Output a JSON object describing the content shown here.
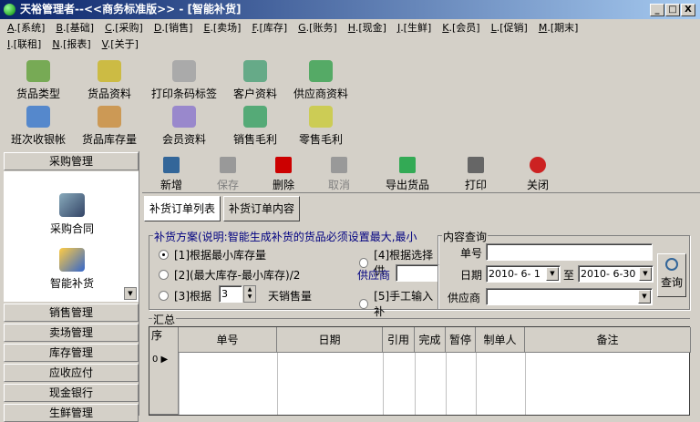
{
  "window": {
    "title": "天裕管理者--<<商务标准版>> - [智能补货]",
    "min": "_",
    "max": "□",
    "close": "X"
  },
  "menu_row1": [
    {
      "k": "A",
      "l": ".[系统]"
    },
    {
      "k": "B",
      "l": ".[基础]"
    },
    {
      "k": "C",
      "l": ".[采购]"
    },
    {
      "k": "D",
      "l": ".[销售]"
    },
    {
      "k": "E",
      "l": ".[卖场]"
    },
    {
      "k": "F",
      "l": ".[库存]"
    },
    {
      "k": "G",
      "l": ".[账务]"
    },
    {
      "k": "H",
      "l": ".[现金]"
    },
    {
      "k": "J",
      "l": ".[生鲜]"
    },
    {
      "k": "K",
      "l": ".[会员]"
    },
    {
      "k": "L",
      "l": ".[促销]"
    },
    {
      "k": "M",
      "l": ".[期末]"
    }
  ],
  "menu_row2": [
    {
      "k": "I",
      "l": ".[联租]"
    },
    {
      "k": "N",
      "l": ".[报表]"
    },
    {
      "k": "V",
      "l": ".[关于]"
    }
  ],
  "quick": [
    "货品类型",
    "货品资料",
    "打印条码标签",
    "客户资料",
    "供应商资料",
    "班次收银帐",
    "货品库存量",
    "会员资料",
    "销售毛利",
    "零售毛利"
  ],
  "left": {
    "header": "采购管理",
    "items": [
      "采购合同",
      "智能补货"
    ],
    "sections": [
      "销售管理",
      "卖场管理",
      "库存管理",
      "应收应付",
      "现金银行",
      "生鲜管理"
    ]
  },
  "toolbar": [
    "新增",
    "保存",
    "删除",
    "取消",
    "导出货品",
    "打印",
    "关闭"
  ],
  "tabs": [
    "补货订单列表",
    "补货订单内容"
  ],
  "plan": {
    "title": "补货方案(说明:智能生成补货的货品必须设置最大,最小",
    "opt1": "[1]根据最小库存量",
    "opt2": "[2](最大库存-最小库存)/2",
    "opt3a": "[3]根据",
    "days": "3",
    "opt3b": "天销售量",
    "opt4": "[4]根据选择供",
    "supplier": "供应商",
    "opt5": "[5]手工输入补"
  },
  "query": {
    "title": "内容查询",
    "no_label": "单号",
    "date_label": "日期",
    "from": "2010- 6- 1",
    "to_label": "至",
    "to": "2010- 6-30",
    "supplier_label": "供应商",
    "button": "查询"
  },
  "summary": {
    "title": "汇总",
    "columns": [
      "序",
      "单号",
      "日期",
      "引用",
      "完成",
      "暂停",
      "制单人",
      "备注"
    ],
    "row_index": "0"
  }
}
